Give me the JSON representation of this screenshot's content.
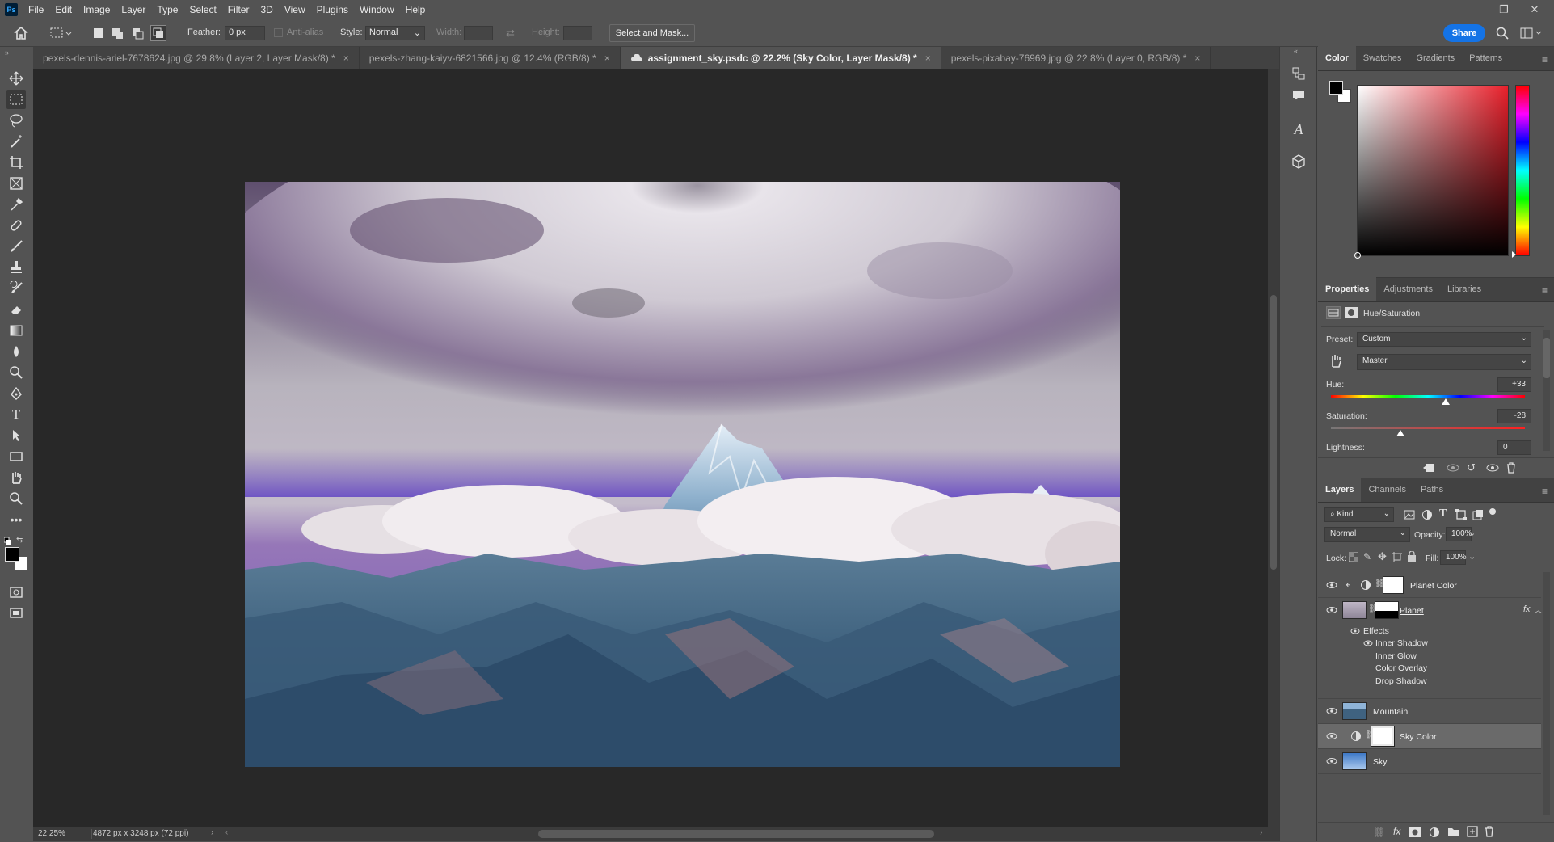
{
  "app": {
    "logo": "Ps",
    "menu": [
      "File",
      "Edit",
      "Image",
      "Layer",
      "Type",
      "Select",
      "Filter",
      "3D",
      "View",
      "Plugins",
      "Window",
      "Help"
    ],
    "window_controls": [
      "—",
      "❐",
      "✕"
    ]
  },
  "options": {
    "feather_label": "Feather:",
    "feather_value": "0 px",
    "antialias_label": "Anti-alias",
    "style_label": "Style:",
    "style_value": "Normal",
    "width_label": "Width:",
    "height_label": "Height:",
    "select_mask_button": "Select and Mask...",
    "share_button": "Share"
  },
  "tabs": [
    {
      "label": "pexels-dennis-ariel-7678624.jpg @ 29.8% (Layer 2, Layer Mask/8) *"
    },
    {
      "label": "pexels-zhang-kaiyv-6821566.jpg @ 12.4% (RGB/8) *"
    },
    {
      "label": "assignment_sky.psdc @ 22.2% (Sky Color, Layer Mask/8) *"
    },
    {
      "label": "pexels-pixabay-76969.jpg @ 22.8% (Layer 0, RGB/8) *"
    }
  ],
  "status": {
    "zoom": "22.25%",
    "doc_size": "4872 px x 3248 px (72 ppi)"
  },
  "color_panel": {
    "tabs": [
      "Color",
      "Swatches",
      "Gradients",
      "Patterns"
    ],
    "foreground": "#000000",
    "background": "#ffffff"
  },
  "properties": {
    "tabs": [
      "Properties",
      "Adjustments",
      "Libraries"
    ],
    "title": "Hue/Saturation",
    "preset_label": "Preset:",
    "preset_value": "Custom",
    "channel_value": "Master",
    "hue_label": "Hue:",
    "hue_value": "+33",
    "hue_level": 0.59,
    "saturation_label": "Saturation:",
    "saturation_value": "-28",
    "saturation_level": 0.36,
    "lightness_label": "Lightness:",
    "lightness_value": "0"
  },
  "layers_panel": {
    "tabs": [
      "Layers",
      "Channels",
      "Paths"
    ],
    "filter_kind": "Kind",
    "blend_mode": "Normal",
    "opacity_label": "Opacity:",
    "opacity_value": "100%",
    "lock_label": "Lock:",
    "fill_label": "Fill:",
    "fill_value": "100%",
    "layers": [
      {
        "name": "Planet Color"
      },
      {
        "name": "Planet",
        "fx": "fx"
      },
      {
        "name": "Mountain"
      },
      {
        "name": "Sky Color"
      },
      {
        "name": "Sky"
      }
    ],
    "effects_label": "Effects",
    "effects": [
      "Inner Shadow",
      "Inner Glow",
      "Color Overlay",
      "Drop Shadow"
    ]
  },
  "colors": {
    "accent": "#1473e6"
  }
}
